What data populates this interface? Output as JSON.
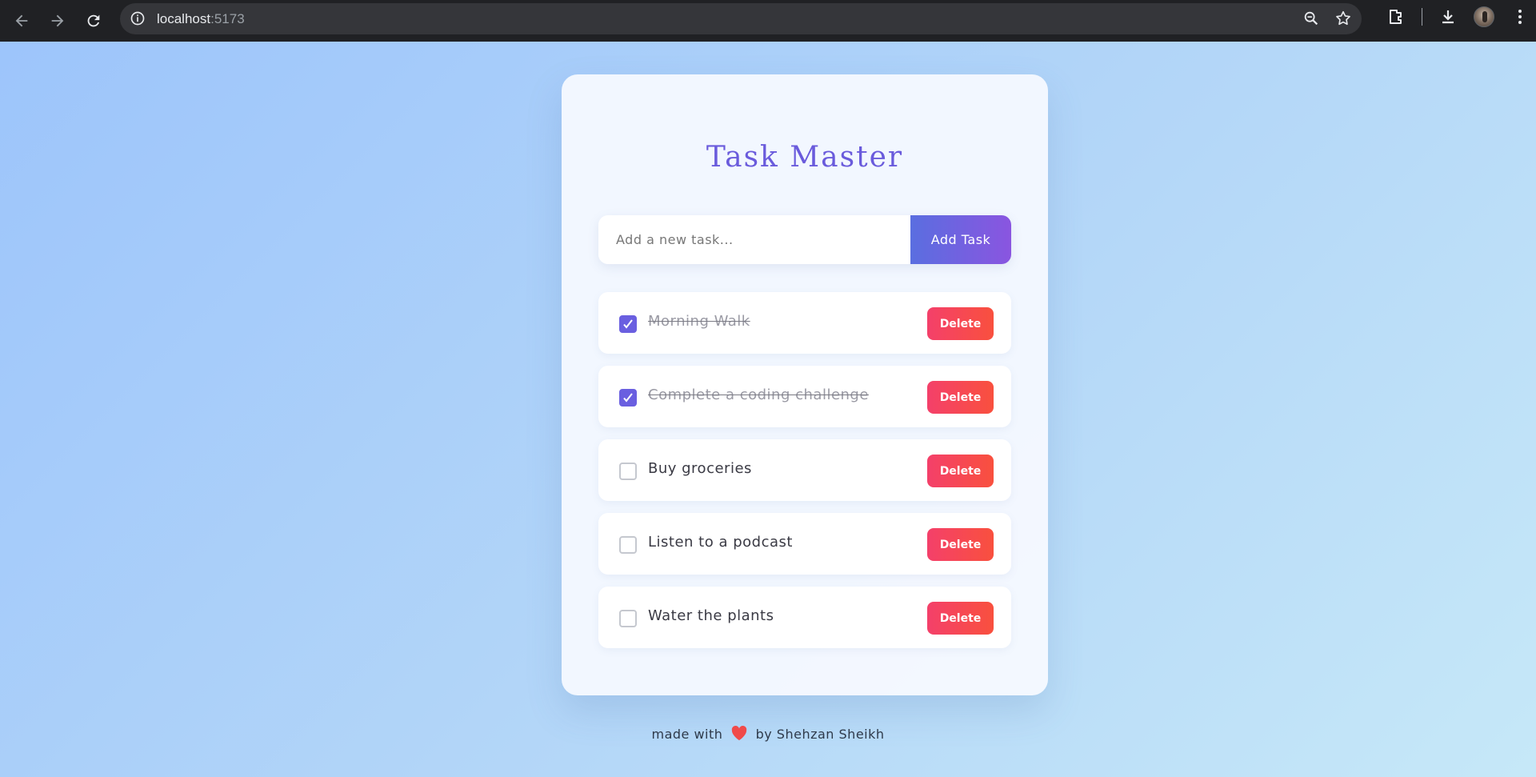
{
  "browser": {
    "url_host": "localhost",
    "url_port": ":5173"
  },
  "app": {
    "title": "Task Master",
    "input_placeholder": "Add a new task...",
    "add_button_label": "Add Task",
    "delete_label": "Delete",
    "tasks": [
      {
        "text": "Morning Walk",
        "completed": true
      },
      {
        "text": "Complete a coding challenge",
        "completed": true
      },
      {
        "text": "Buy groceries",
        "completed": false
      },
      {
        "text": "Listen to a podcast",
        "completed": false
      },
      {
        "text": "Water the plants",
        "completed": false
      }
    ]
  },
  "footer": {
    "prefix": "made with",
    "suffix": "by Shehzan Sheikh"
  },
  "colors": {
    "accent": "#6a5fe0",
    "delete": "#f4406a",
    "heart": "#f04a4a"
  }
}
